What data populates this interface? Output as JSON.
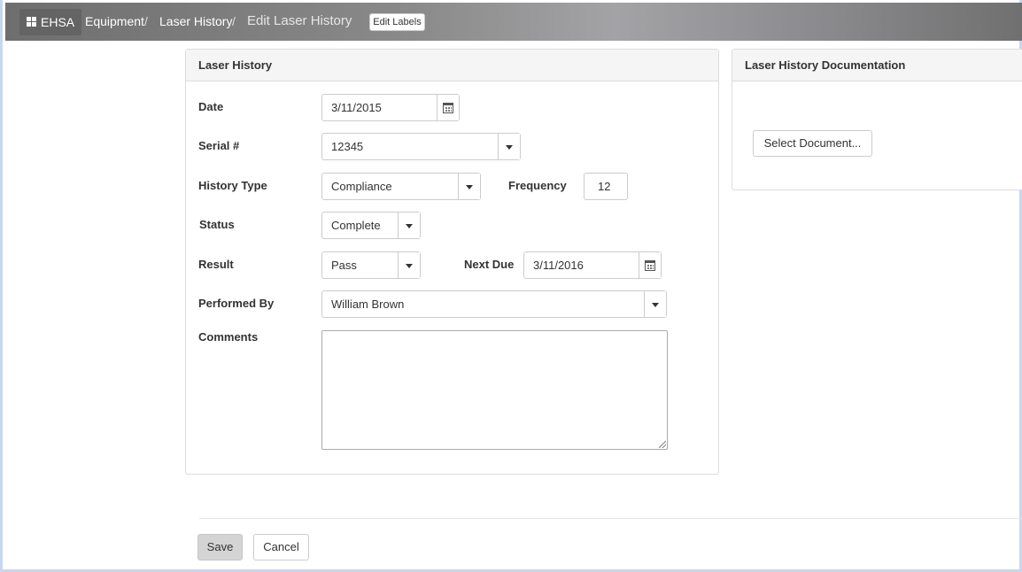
{
  "nav": {
    "brand": "EHSA",
    "crumbs": [
      "Equipment",
      "Laser History"
    ],
    "separator": "/",
    "current": "Edit Laser History",
    "edit_labels": "Edit Labels"
  },
  "form": {
    "heading": "Laser History",
    "date_label": "Date",
    "date_value": "3/11/2015",
    "serial_label": "Serial #",
    "serial_value": "12345",
    "history_type_label": "History Type",
    "history_type_value": "Compliance",
    "frequency_label": "Frequency",
    "frequency_value": "12",
    "status_label": "Status",
    "status_value": "Complete",
    "result_label": "Result",
    "result_value": "Pass",
    "next_due_label": "Next Due",
    "next_due_value": "3/11/2016",
    "performed_by_label": "Performed By",
    "performed_by_value": "William Brown",
    "comments_label": "Comments",
    "comments_value": ""
  },
  "docs": {
    "heading": "Laser History Documentation",
    "select_button": "Select Document..."
  },
  "actions": {
    "save": "Save",
    "cancel": "Cancel"
  }
}
